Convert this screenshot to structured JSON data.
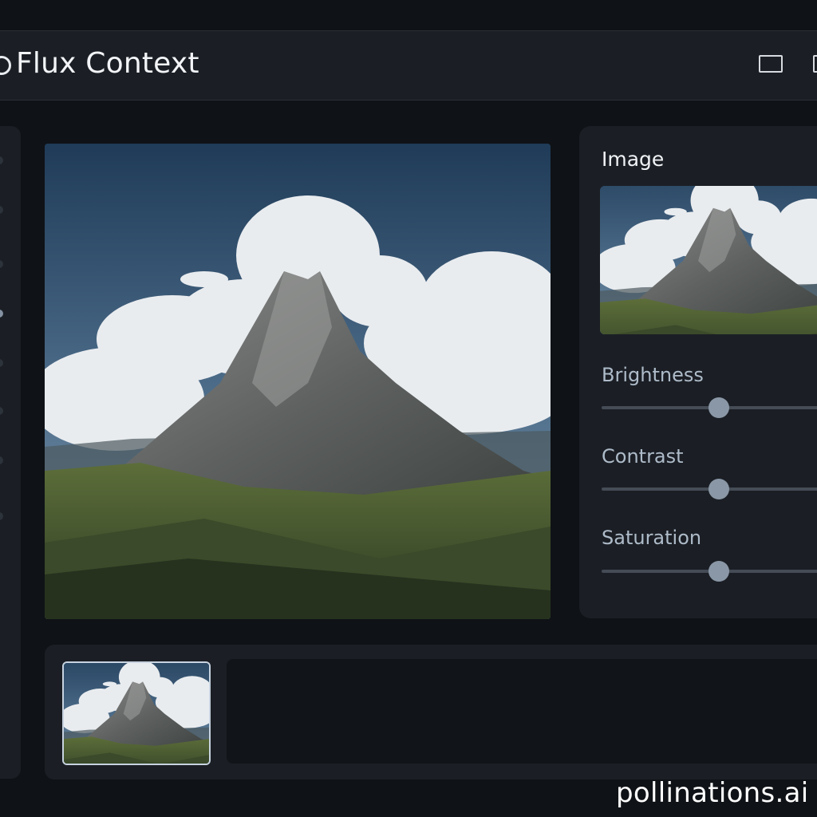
{
  "app": {
    "title": "Flux Context"
  },
  "left_rail": {
    "items": [
      "tool-1",
      "tool-2",
      "tool-3",
      "tool-4",
      "tool-5",
      "tool-6",
      "tool-7",
      "tool-8"
    ],
    "active_index": 3
  },
  "main": {
    "image_alt": "mountain landscape"
  },
  "properties": {
    "section_title": "Image",
    "sliders": [
      {
        "label": "Brightness",
        "value": 0.49
      },
      {
        "label": "Contrast",
        "value": 0.49
      },
      {
        "label": "Saturation",
        "value": 0.49
      }
    ]
  },
  "watermark": "pollinations.ai",
  "colors": {
    "background": "#0f1216",
    "panel": "#1b1f25",
    "accent": "#8a97a6",
    "label": "#aebbc9"
  }
}
